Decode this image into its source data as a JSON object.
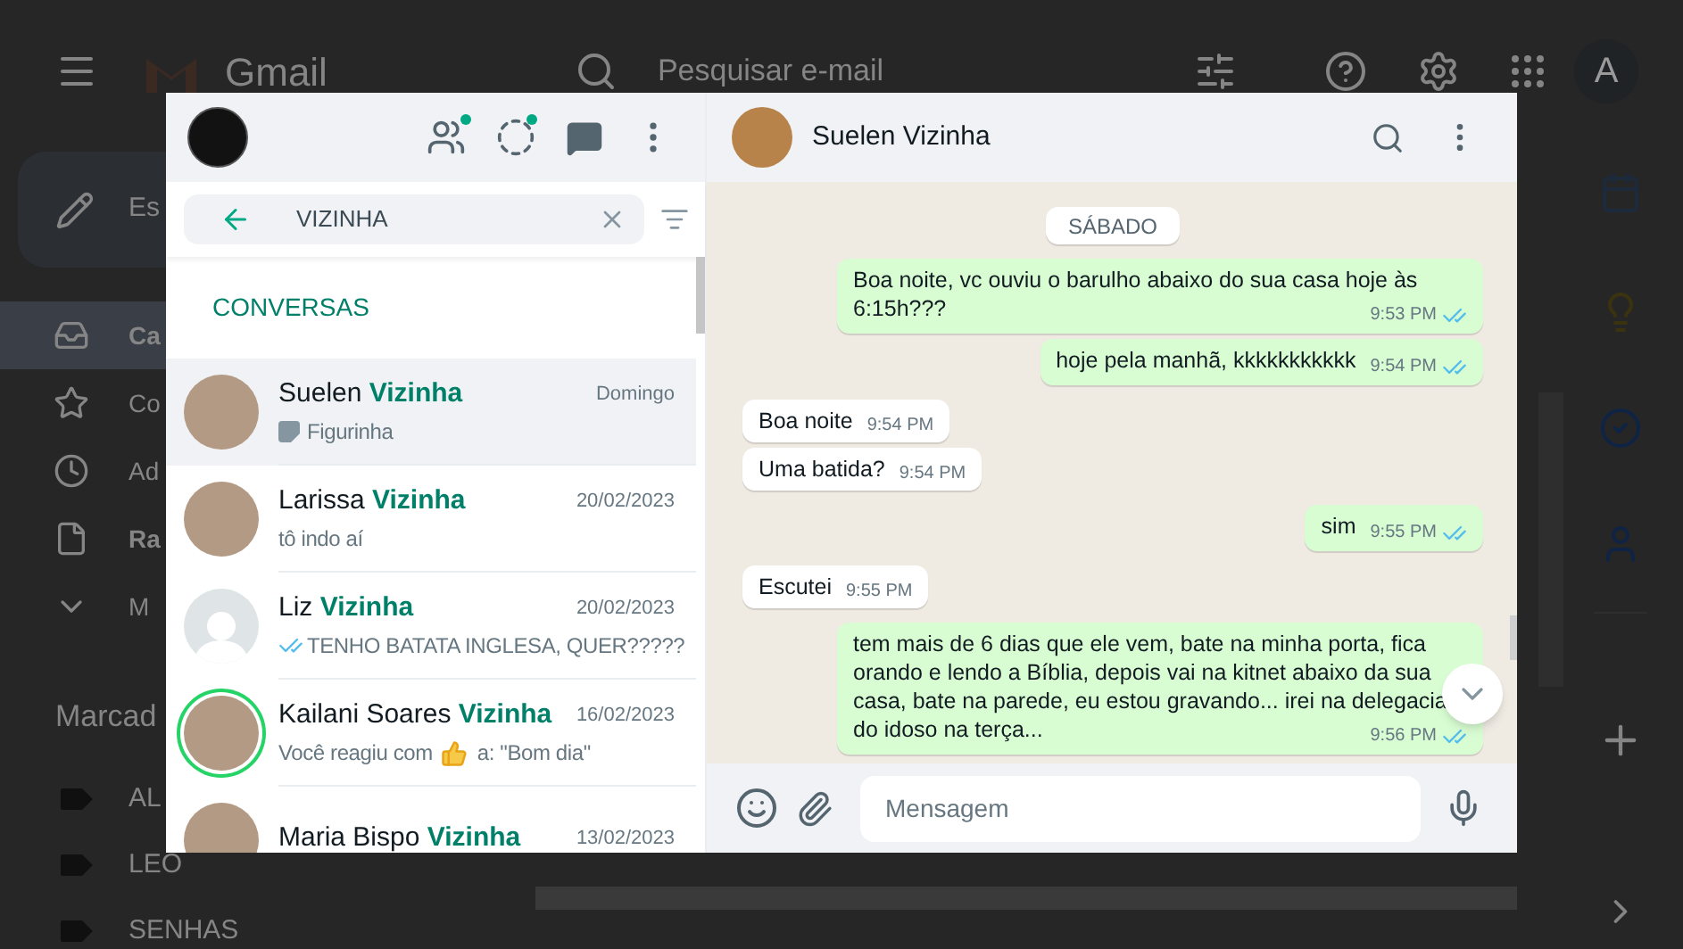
{
  "gmail": {
    "title": "Gmail",
    "search_placeholder": "Pesquisar e-mail",
    "account_initial": "A",
    "compose_label": "Es",
    "nav": [
      {
        "label": "Ca",
        "selected": true,
        "unread": true
      },
      {
        "label": "Co",
        "selected": false,
        "unread": false
      },
      {
        "label": "Ad",
        "selected": false,
        "unread": false
      },
      {
        "label": "Ra",
        "selected": false,
        "unread": true
      },
      {
        "label": "M",
        "selected": false,
        "unread": false
      }
    ],
    "labels_heading": "Marcad",
    "labels": [
      "AL",
      "LEO",
      "SENHAS"
    ]
  },
  "chat_list": {
    "search_value": "VIZINHA",
    "section_title": "CONVERSAS",
    "chats": [
      {
        "name": "Suelen **Vizinha**",
        "date": "Domingo",
        "kind": "sticker",
        "preview": "Figurinha",
        "selected": true,
        "status_ring": false,
        "has_photo": true
      },
      {
        "name": "Larissa **Vizinha**",
        "date": "20/02/2023",
        "kind": "text",
        "preview": "tô indo aí",
        "selected": false,
        "status_ring": false,
        "has_photo": true
      },
      {
        "name": "Liz **Vizinha**",
        "date": "20/02/2023",
        "kind": "sent",
        "preview": "TENHO BATATA INGLESA, QUER?????",
        "read": true,
        "selected": false,
        "status_ring": false,
        "has_photo": false
      },
      {
        "name": "Kailani Soares **Vizinha**",
        "date": "16/02/2023",
        "kind": "reaction",
        "preview": "Você reagiu com",
        "preview_after": "a: \"Bom dia\"",
        "selected": false,
        "status_ring": true,
        "has_photo": true
      },
      {
        "name": "Maria Bispo **Vizinha**",
        "date": "13/02/2023",
        "kind": "none",
        "selected": false,
        "status_ring": false,
        "has_photo": true
      }
    ]
  },
  "conversation": {
    "contact": "Suelen Vizinha",
    "day_label": "SÁBADO",
    "messages": [
      {
        "kind": "outgoing",
        "text": "Boa noite, vc ouviu o barulho abaixo do sua casa hoje às 6:15h???",
        "time": "9:53 PM",
        "read": true
      },
      {
        "kind": "outgoing",
        "text": "hoje pela  manhã, kkkkkkkkkkk",
        "time": "9:54 PM",
        "read": true
      },
      {
        "kind": "incoming",
        "text": "Boa noite",
        "time": "9:54 PM"
      },
      {
        "kind": "incoming",
        "text": "Uma batida?",
        "time": "9:54 PM"
      },
      {
        "kind": "outgoing",
        "text": "sim",
        "time": "9:55 PM",
        "read": true
      },
      {
        "kind": "incoming",
        "text": "Escutei",
        "time": "9:55 PM"
      },
      {
        "kind": "outgoing",
        "text": "tem mais de 6 dias que ele vem, bate na minha porta, fica orando e lendo a Bíblia, depois vai na kitnet abaixo da sua casa, bate na parede, eu estou gravando... irei na delegacia do idoso na terça...",
        "time": "9:56 PM",
        "read": true
      }
    ],
    "composer_placeholder": "Mensagem"
  }
}
